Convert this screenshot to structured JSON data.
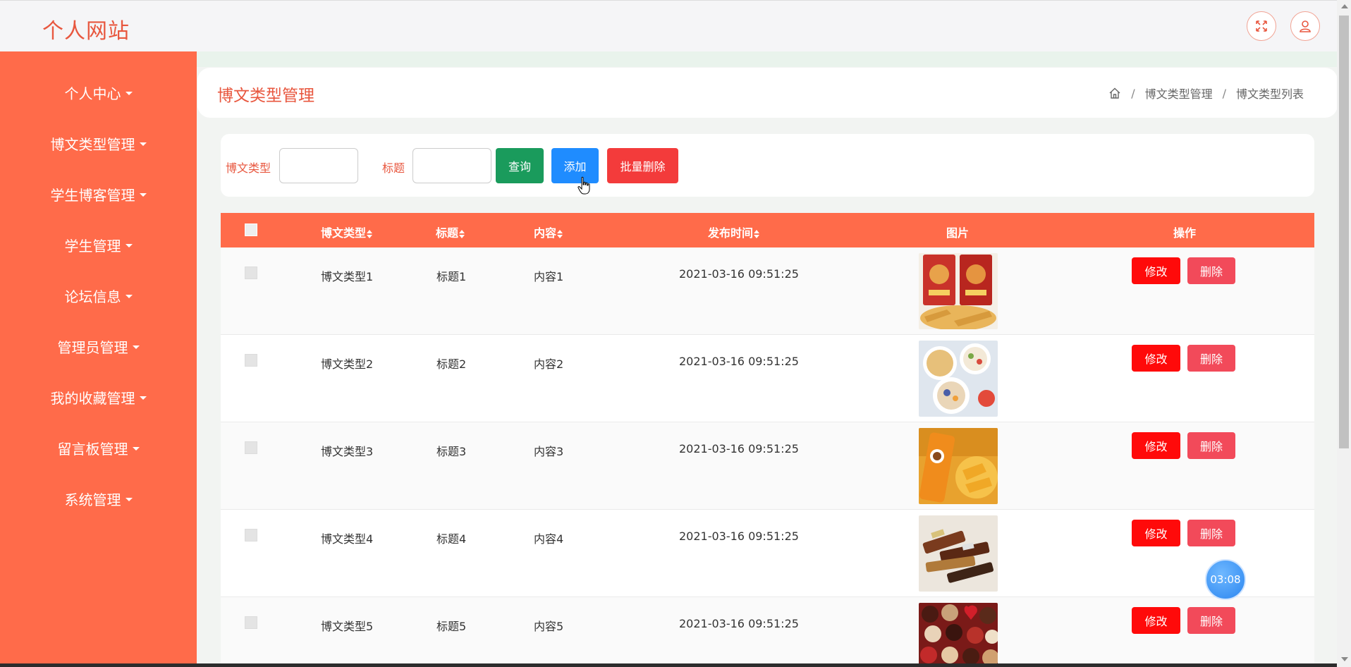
{
  "app": {
    "brand": "个人网站"
  },
  "topbar": {
    "icons": [
      "fullscreen-icon",
      "user-icon"
    ]
  },
  "sidebar": {
    "items": [
      {
        "label": "个人中心"
      },
      {
        "label": "博文类型管理"
      },
      {
        "label": "学生博客管理"
      },
      {
        "label": "学生管理"
      },
      {
        "label": "论坛信息"
      },
      {
        "label": "管理员管理"
      },
      {
        "label": "我的收藏管理"
      },
      {
        "label": "留言板管理"
      },
      {
        "label": "系统管理"
      }
    ]
  },
  "header": {
    "title": "博文类型管理",
    "breadcrumb": [
      "博文类型管理",
      "博文类型列表"
    ]
  },
  "search": {
    "type_label": "博文类型",
    "type_value": "",
    "title_label": "标题",
    "title_value": "",
    "query_button": "查询",
    "add_button": "添加",
    "batch_delete_button": "批量删除"
  },
  "table": {
    "headers": {
      "type": "博文类型",
      "title": "标题",
      "content": "内容",
      "time": "发布时间",
      "image": "图片",
      "action": "操作"
    },
    "rows": [
      {
        "type": "博文类型1",
        "title": "标题1",
        "content": "内容1",
        "time": "2021-03-16 09:51:25",
        "edit": "修改",
        "delete": "删除"
      },
      {
        "type": "博文类型2",
        "title": "标题2",
        "content": "内容2",
        "time": "2021-03-16 09:51:25",
        "edit": "修改",
        "delete": "删除"
      },
      {
        "type": "博文类型3",
        "title": "标题3",
        "content": "内容3",
        "time": "2021-03-16 09:51:25",
        "edit": "修改",
        "delete": "删除"
      },
      {
        "type": "博文类型4",
        "title": "标题4",
        "content": "内容4",
        "time": "2021-03-16 09:51:25",
        "edit": "修改",
        "delete": "删除"
      },
      {
        "type": "博文类型5",
        "title": "标题5",
        "content": "内容5",
        "time": "2021-03-16 09:51:25",
        "edit": "修改",
        "delete": "删除"
      }
    ]
  },
  "timer": {
    "text": "03:08"
  },
  "colors": {
    "accent": "#ff6b4a",
    "brand": "#e8573f",
    "query": "#1a9b5c",
    "add": "#1f8cff",
    "batch_delete": "#f33b3b",
    "edit": "#ff0a0a",
    "delete": "#f24a5a"
  }
}
